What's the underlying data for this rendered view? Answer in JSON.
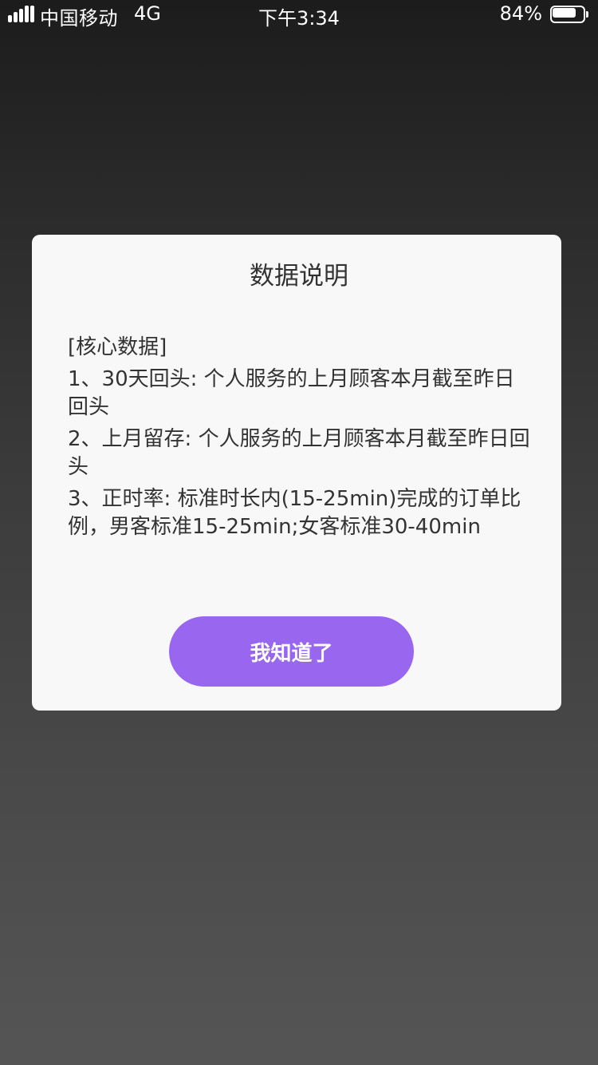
{
  "status_bar": {
    "carrier": "中国移动",
    "network": "4G",
    "time": "下午3:34",
    "battery_percent": "84%",
    "battery_level": 0.84,
    "signal_icon": "signal-bars-icon",
    "battery_icon": "battery-icon"
  },
  "dialog": {
    "title": "数据说明",
    "section_heading": "[核心数据]",
    "items": [
      "1、30天回头: 个人服务的上月顾客本月截至昨日回头",
      "2、上月留存: 个人服务的上月顾客本月截至昨日回头",
      "3、正时率: 标准时长内(15-25min)完成的订单比例，男客标准15-25min;女客标准30-40min"
    ],
    "confirm_label": "我知道了"
  },
  "colors": {
    "accent": "#9966f0",
    "dialog_background": "#f8f8f8",
    "text": "#333333"
  }
}
